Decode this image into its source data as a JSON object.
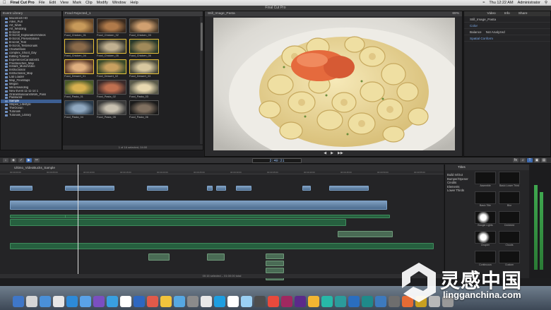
{
  "menubar": {
    "app": "Final Cut Pro",
    "items": [
      "File",
      "Edit",
      "View",
      "Mark",
      "Clip",
      "Modify",
      "Window",
      "Help"
    ],
    "clock": "Thu 12:22 AM",
    "user": "Administrator"
  },
  "window_title": "Final Cut Pro",
  "library": {
    "header": "Event Library",
    "items": [
      "Macintosh HD",
      "Allen_Pull",
      "Art_Work",
      "Art_Wedding",
      "B-Scroll",
      "B-Scroll_ExplanationVideos",
      "B-Scroll_Presentations",
      "B-scroll_Test",
      "B-Scroll_Testimonials",
      "CharlieMoss",
      "complex_Shoot_Day",
      "Editing Tutorial",
      "ExperienceCaroldon01",
      "Freebeaches_Map",
      "Instant_MusicVideo",
      "Instructional",
      "Instructional_Map",
      "Lab Loader",
      "Map_FreeMaps",
      "Megan",
      "MiniUnwinding",
      "New Event 11-11-14 1",
      "OnlineMusiciansWork_Pass",
      "Password",
      "Sample",
      "Stripes_Lifestyle",
      "TheOcean",
      "Tutorials",
      "Tutorials_Library"
    ],
    "selected_index": 24
  },
  "browser": {
    "header": "Food Rejected_1",
    "clips": [
      {
        "label": "Food_Chicken_01",
        "sel": false
      },
      {
        "label": "Food_Chicken_02",
        "sel": false
      },
      {
        "label": "Food_Chicken_03",
        "sel": false
      },
      {
        "label": "Food_Chicken_04",
        "sel": true
      },
      {
        "label": "Food_Chicken_05",
        "sel": true
      },
      {
        "label": "Food_Chicken_06",
        "sel": true
      },
      {
        "label": "Food_Dessert_01",
        "sel": true
      },
      {
        "label": "Food_Dessert_02",
        "sel": true
      },
      {
        "label": "Food_Dessert_03",
        "sel": true
      },
      {
        "label": "Food_Pasta_01",
        "sel": false
      },
      {
        "label": "Food_Pasta_02",
        "sel": false
      },
      {
        "label": "Food_Pasta_03",
        "sel": false
      },
      {
        "label": "Food_Pasta_04",
        "sel": false
      },
      {
        "label": "Food_Pasta_05",
        "sel": false
      },
      {
        "label": "Food_Pasta_06",
        "sel": false
      }
    ],
    "footer": "1 of 16 selected, 04:00"
  },
  "viewer": {
    "header_left": "Still_Image_Pasta",
    "header_right": "69%",
    "controls": [
      "◀",
      "▶",
      "▶▶"
    ]
  },
  "inspector": {
    "tabs": [
      "Video",
      "Info",
      "Share"
    ],
    "clip_name": "Still_Image_Pasta",
    "rows": [
      {
        "k": "Color",
        "v": ""
      },
      {
        "k": "Balance",
        "v": "Not Analyzed"
      },
      {
        "k": "Spatial Conform",
        "v": ""
      }
    ]
  },
  "toolbar": {
    "timecode": "2:40:21"
  },
  "timeline": {
    "header": "Ultimo_VideoBucks_Sample",
    "ruler": [
      "00:00:00:00",
      "00:00:05:00",
      "00:00:10:00",
      "00:00:15:00",
      "00:00:20:00",
      "00:00:25:00",
      "00:00:30:00",
      "00:00:35:00",
      "00:00:40:00",
      "00:00:45:00",
      "00:00:50:00",
      "00:00:55:00"
    ],
    "footer": "00:15 selected – 01:00:00 total"
  },
  "effects": {
    "header": "Titles",
    "categories": [
      "Build In/Out",
      "Bumper/Opener",
      "Credits",
      "Elements",
      "Lower Thirds"
    ],
    "items": [
      "Assemble",
      "Basic Lower Third",
      "Basic Title",
      "Blur",
      "Boogie Lights",
      "Centered",
      "Chapter",
      "Clouds",
      "Continuous",
      "Custom"
    ]
  },
  "dock": {
    "icon_colors": [
      "#3f77c8",
      "#d6d6d6",
      "#4a90d8",
      "#e6e6e6",
      "#2d8ad8",
      "#5aa2e8",
      "#7b4fc0",
      "#39a0e0",
      "#ffffff",
      "#2e67c0",
      "#e05a4a",
      "#f1c33c",
      "#56a8e2",
      "#8b8b8b",
      "#e8e8e8",
      "#1e9ee0",
      "#ffffff",
      "#9ad0f4",
      "#4d4d4d",
      "#e84a3c",
      "#a02860",
      "#5a2a8a",
      "#f2b632",
      "#27b8a8",
      "#2b9b9b",
      "#2a6ec0",
      "#1f8a8a",
      "#3d7abe",
      "#6e6e6e",
      "#e56b34",
      "#c8a020",
      "#b8b8b8",
      "#999999"
    ]
  },
  "watermark": {
    "cn": "灵感中国",
    "url": "lingganchina.com"
  }
}
